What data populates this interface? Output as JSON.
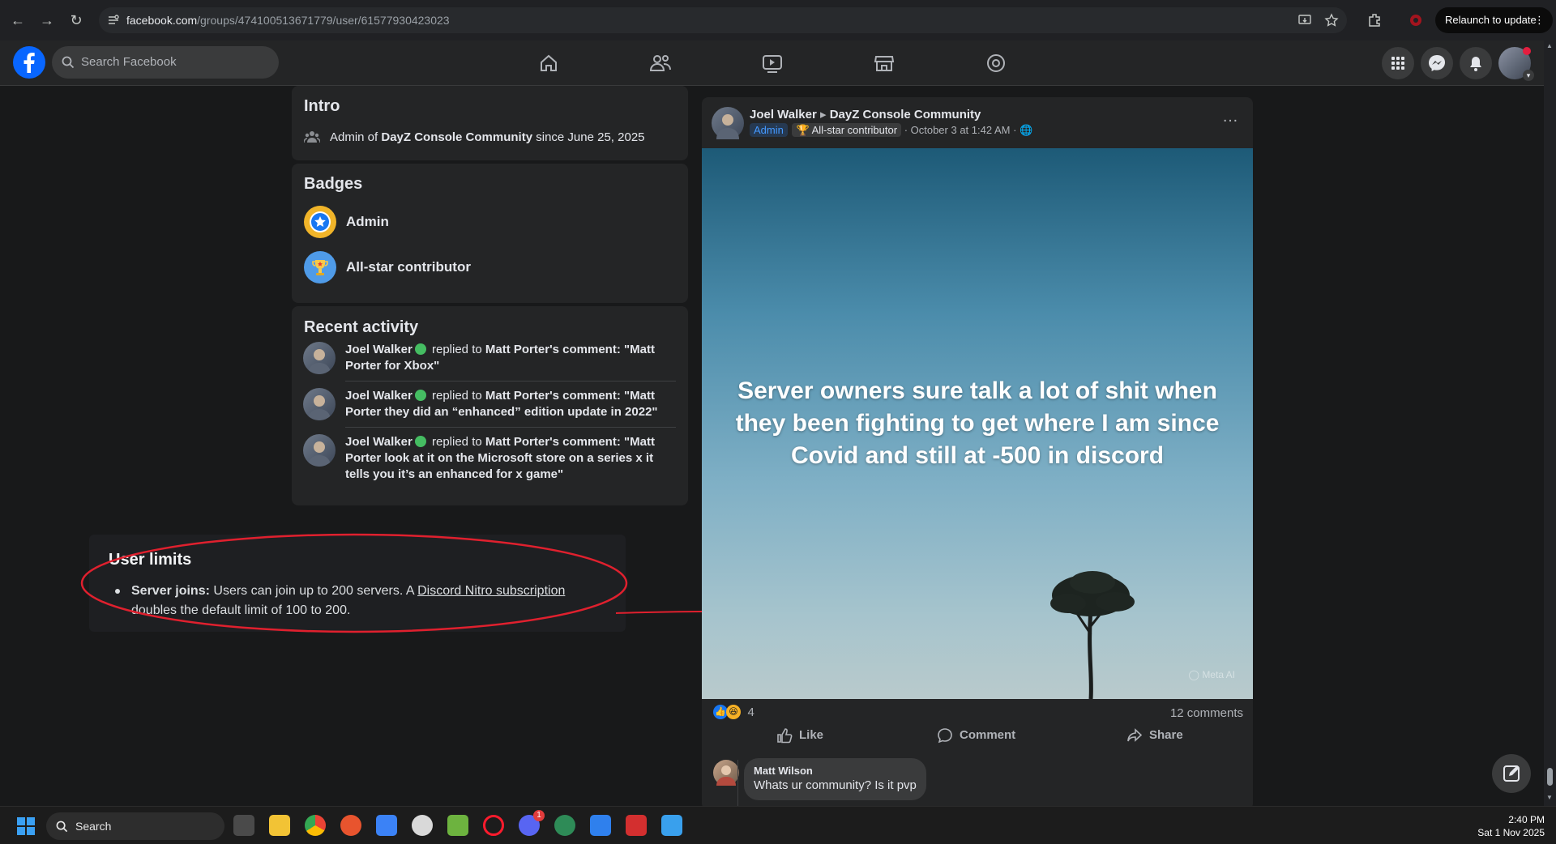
{
  "browser": {
    "url_host": "facebook.com",
    "url_path": "/groups/474100513671779/user/61577930423023",
    "relaunch_label": "Relaunch to update"
  },
  "header": {
    "search_placeholder": "Search Facebook"
  },
  "intro": {
    "title": "Intro",
    "line_prefix": "Admin of",
    "group_name": "DayZ Console Community",
    "line_suffix": "since June 25, 2025"
  },
  "badges": {
    "title": "Badges",
    "items": [
      {
        "label": "Admin"
      },
      {
        "label": "All-star contributor"
      }
    ]
  },
  "recent_activity": {
    "title": "Recent activity",
    "items": [
      {
        "user": "Joel Walker",
        "action": "replied to",
        "target": "Matt Porter",
        "comment": "'s comment: \"Matt Porter for Xbox\""
      },
      {
        "user": "Joel Walker",
        "action": "replied to",
        "target": "Matt Porter",
        "comment": "'s comment: \"Matt Porter they did an “enhanced” edition update in 2022\""
      },
      {
        "user": "Joel Walker",
        "action": "replied to",
        "target": "Matt Porter",
        "comment": "'s comment: \"Matt Porter look at it on the Microsoft store on a series x it tells you it’s an enhanced for x game\""
      }
    ]
  },
  "user_limits": {
    "title": "User limits",
    "label": "Server joins:",
    "text_before": " Users can join up to 200 servers. A ",
    "link": "Discord Nitro subscription",
    "text_after": " doubles the default limit of 100 to 200."
  },
  "post": {
    "author": "Joel Walker",
    "group": "DayZ Console Community",
    "role_badge": "Admin",
    "contributor_badge": "All-star contributor",
    "timestamp": "· October 3 at 1:42 AM ·",
    "image_text": "Server owners sure talk a lot of shit when they been fighting to get where I am since Covid and still at -500 in discord",
    "watermark": "Meta AI",
    "reaction_count": "4",
    "comments_count": "12 comments",
    "like_label": "Like",
    "comment_label": "Comment",
    "share_label": "Share",
    "first_comment_author": "Matt Wilson",
    "first_comment_text": "Whats ur community? Is it pvp"
  },
  "taskbar": {
    "search_label": "Search",
    "time": "2:40 PM",
    "date": "Sat 1 Nov 2025",
    "discord_badge": "1"
  },
  "colors": {
    "fb_blue": "#0866ff",
    "annotation_red": "#e0202e",
    "online_green": "#45bd62"
  }
}
